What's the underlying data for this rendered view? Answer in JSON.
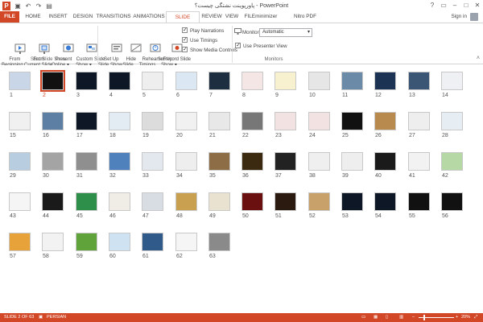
{
  "window": {
    "title": "پاورپوینت نشتگی چیست؟ - PowerPoint"
  },
  "quick_access": [
    "save-icon",
    "undo-icon",
    "redo-icon",
    "slideshow-icon"
  ],
  "window_controls": [
    "?",
    "▭",
    "–",
    "□",
    "✕"
  ],
  "tabs": [
    {
      "label": "FILE"
    },
    {
      "label": "HOME"
    },
    {
      "label": "INSERT"
    },
    {
      "label": "DESIGN"
    },
    {
      "label": "TRANSITIONS"
    },
    {
      "label": "ANIMATIONS"
    },
    {
      "label": "SLIDE SHOW"
    },
    {
      "label": "REVIEW"
    },
    {
      "label": "VIEW"
    },
    {
      "label": "FILEminimizer"
    },
    {
      "label": "Nitro PDF Professional"
    }
  ],
  "account": {
    "sign_in": "Sign in"
  },
  "ribbon": {
    "start_group": {
      "label": "Start Slide Show",
      "from_beginning": "From\nBeginning",
      "from_current": "From\nCurrent Slide",
      "present_online": "Present\nOnline ▾",
      "custom_show": "Custom Slide\nShow ▾"
    },
    "setup_group": {
      "label": "Set Up",
      "setup_show": "Set Up\nSlide Show",
      "hide_slide": "Hide\nSlide",
      "rehearse": "Rehearse\nTimings",
      "record": "Record Slide\nShow ▾",
      "play_narrations": "Play Narrations",
      "use_timings": "Use Timings",
      "show_media_controls": "Show Media Controls"
    },
    "monitors_group": {
      "label": "Monitors",
      "monitor_label": "Monitor:",
      "monitor_value": "Automatic",
      "presenter_view": "Use Presenter View"
    }
  },
  "slides": [
    {
      "n": "1",
      "c": "#c8d6e8"
    },
    {
      "n": "2",
      "c": "#111111"
    },
    {
      "n": "3",
      "c": "#0d1726"
    },
    {
      "n": "4",
      "c": "#0d1726"
    },
    {
      "n": "5",
      "c": "#eeeeee"
    },
    {
      "n": "6",
      "c": "#dbe7f2"
    },
    {
      "n": "7",
      "c": "#1d2e40"
    },
    {
      "n": "8",
      "c": "#f5e6e6"
    },
    {
      "n": "9",
      "c": "#f7f1d0"
    },
    {
      "n": "10",
      "c": "#e6e6e6"
    },
    {
      "n": "11",
      "c": "#6a8aa8"
    },
    {
      "n": "12",
      "c": "#1c3354"
    },
    {
      "n": "13",
      "c": "#3a5674"
    },
    {
      "n": "14",
      "c": "#eef0f3"
    },
    {
      "n": "15",
      "c": "#f0f0f0"
    },
    {
      "n": "16",
      "c": "#5d7fa3"
    },
    {
      "n": "17",
      "c": "#0d1726"
    },
    {
      "n": "18",
      "c": "#e3ebf3"
    },
    {
      "n": "19",
      "c": "#dcdcdc"
    },
    {
      "n": "20",
      "c": "#f1f1f1"
    },
    {
      "n": "21",
      "c": "#e8e8e8"
    },
    {
      "n": "22",
      "c": "#777777"
    },
    {
      "n": "23",
      "c": "#f3e2e2"
    },
    {
      "n": "24",
      "c": "#f3e2e2"
    },
    {
      "n": "25",
      "c": "#111111"
    },
    {
      "n": "26",
      "c": "#b98a4e"
    },
    {
      "n": "27",
      "c": "#eeeeee"
    },
    {
      "n": "28",
      "c": "#e6edf3"
    },
    {
      "n": "29",
      "c": "#b9cde0"
    },
    {
      "n": "30",
      "c": "#a4a4a4"
    },
    {
      "n": "31",
      "c": "#8f8f8f"
    },
    {
      "n": "32",
      "c": "#4f81bd"
    },
    {
      "n": "33",
      "c": "#e3e8ee"
    },
    {
      "n": "34",
      "c": "#eeeeee"
    },
    {
      "n": "35",
      "c": "#8c6d46"
    },
    {
      "n": "36",
      "c": "#3b2a10"
    },
    {
      "n": "37",
      "c": "#222222"
    },
    {
      "n": "38",
      "c": "#efefef"
    },
    {
      "n": "39",
      "c": "#eeeeee"
    },
    {
      "n": "40",
      "c": "#1a1a1a"
    },
    {
      "n": "41",
      "c": "#f2f2f2"
    },
    {
      "n": "42",
      "c": "#b5d8a5"
    },
    {
      "n": "43",
      "c": "#f5f5f5"
    },
    {
      "n": "44",
      "c": "#1a1a1a"
    },
    {
      "n": "45",
      "c": "#2e8f4a"
    },
    {
      "n": "46",
      "c": "#f0ece6"
    },
    {
      "n": "47",
      "c": "#d8dde3"
    },
    {
      "n": "48",
      "c": "#c9a050"
    },
    {
      "n": "49",
      "c": "#e9e2d0"
    },
    {
      "n": "50",
      "c": "#6b1010"
    },
    {
      "n": "51",
      "c": "#2a1a10"
    },
    {
      "n": "52",
      "c": "#c8a16a"
    },
    {
      "n": "53",
      "c": "#0d1726"
    },
    {
      "n": "54",
      "c": "#0d1726"
    },
    {
      "n": "55",
      "c": "#111111"
    },
    {
      "n": "56",
      "c": "#111111"
    },
    {
      "n": "57",
      "c": "#e8a23a"
    },
    {
      "n": "58",
      "c": "#f2f2f2"
    },
    {
      "n": "59",
      "c": "#5fa33a"
    },
    {
      "n": "60",
      "c": "#cfe2f2"
    },
    {
      "n": "61",
      "c": "#2f5a8a"
    },
    {
      "n": "62",
      "c": "#f5f5f5"
    },
    {
      "n": "63",
      "c": "#8a8a8a"
    }
  ],
  "selected_slide": "2",
  "statusbar": {
    "slide_info": "SLIDE 2 OF 63",
    "language": "PERSIAN",
    "zoom_minus": "–",
    "zoom_plus": "+",
    "zoom": "20%"
  },
  "colors": {
    "accent": "#d24726"
  }
}
